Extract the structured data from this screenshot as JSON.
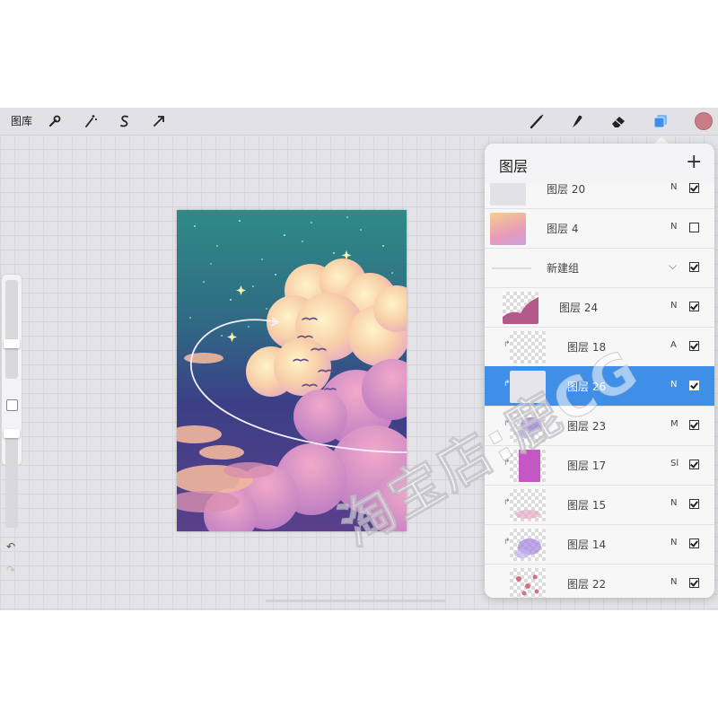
{
  "toolbar": {
    "gallery_label": "图库",
    "left_icons": [
      "wrench-icon",
      "magic-wand-icon",
      "selection-s-icon",
      "transform-arrow-icon"
    ],
    "right_icons": [
      "brush-icon",
      "smudge-icon",
      "eraser-icon",
      "layers-icon"
    ],
    "current_color": "#c97b86"
  },
  "layers_panel": {
    "title": "图层",
    "add_icon": "+",
    "layers": [
      {
        "name": "图层 20",
        "mode": "N",
        "visible": true
      },
      {
        "name": "图层 4",
        "mode": "N",
        "visible": false
      },
      {
        "name": "新建组",
        "mode": "",
        "visible": true,
        "group": true
      },
      {
        "name": "图层 24",
        "mode": "N",
        "visible": true
      },
      {
        "name": "图层 18",
        "mode": "A",
        "visible": true,
        "clipped": true
      },
      {
        "name": "图层 26",
        "mode": "N",
        "visible": true,
        "clipped": true,
        "selected": true
      },
      {
        "name": "图层 23",
        "mode": "M",
        "visible": true,
        "clipped": true
      },
      {
        "name": "图层 17",
        "mode": "Sl",
        "visible": true,
        "clipped": true
      },
      {
        "name": "图层 15",
        "mode": "N",
        "visible": true,
        "clipped": true
      },
      {
        "name": "图层 14",
        "mode": "N",
        "visible": true,
        "clipped": true
      },
      {
        "name": "图层 22",
        "mode": "N",
        "visible": true,
        "clipped": true
      }
    ]
  },
  "sidebar": {
    "undo_icon": "↶",
    "redo_icon": "↷"
  },
  "watermark": "淘宝店:鹿CG",
  "colors": {
    "accent": "#3d8fe8",
    "sky_top": "#2f8b86",
    "sky_mid": "#3b3f86",
    "cloud": "#f2b6c9"
  }
}
